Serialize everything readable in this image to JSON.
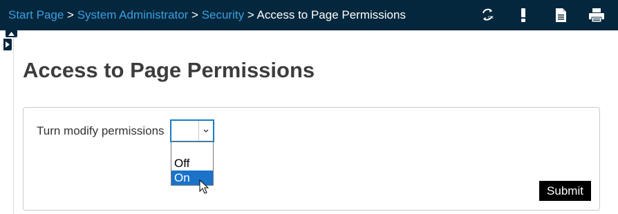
{
  "header": {
    "breadcrumb": [
      {
        "label": "Start Page",
        "link": true
      },
      {
        "label": "System Administrator",
        "link": true
      },
      {
        "label": "Security",
        "link": true
      },
      {
        "label": "Access to Page Permissions",
        "link": false
      }
    ],
    "separator": " > ",
    "toolbar_icons": [
      "refresh-settings-icon",
      "exclamation-icon",
      "document-icon",
      "printer-icon"
    ]
  },
  "page": {
    "title": "Access to Page Permissions"
  },
  "form": {
    "label": "Turn modify permissions",
    "select_value": "",
    "options": [
      "",
      "Off",
      "On"
    ],
    "highlighted_option": "On",
    "submit_label": "Submit"
  },
  "colors": {
    "header_bg": "#05273d",
    "link": "#3a9fe0",
    "select_border": "#1a7ac4",
    "highlight": "#1a73c9",
    "button_bg": "#000000"
  }
}
